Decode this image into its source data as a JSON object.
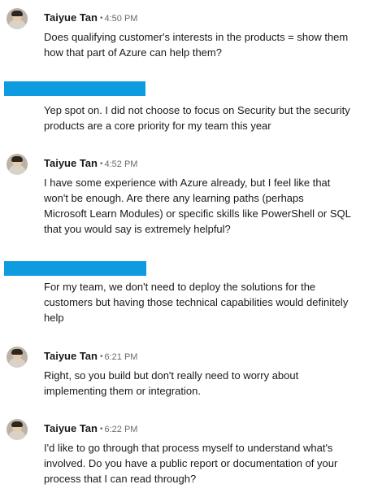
{
  "messages": [
    {
      "sender": "Taiyue Tan",
      "time": "4:50 PM",
      "lines": [
        "Does qualifying customer's interests in the products = show them",
        "how that part of Azure can help them?"
      ]
    },
    {
      "redacted": true,
      "lines": [
        "Yep spot on. I did not choose to focus on Security but the security",
        "products are a core priority for my team this year"
      ]
    },
    {
      "sender": "Taiyue Tan",
      "time": "4:52 PM",
      "lines": [
        "I have some experience with Azure already, but I feel like that",
        "won't be enough. Are there any learning paths (perhaps",
        "Microsoft Learn Modules) or specific skills like PowerShell or SQL",
        "that you would say is extremely helpful?"
      ]
    },
    {
      "redacted": true,
      "lines": [
        "For my team, we don't need to deploy the solutions for the",
        "customers but having those technical capabilities would definitely",
        "help"
      ]
    },
    {
      "sender": "Taiyue Tan",
      "time": "6:21 PM",
      "lines": [
        "Right, so you build but don't really need to worry about",
        "implementing them or integration."
      ]
    },
    {
      "sender": "Taiyue Tan",
      "time": "6:22 PM",
      "lines": [
        "I'd like to go through that process myself to understand what's",
        "involved. Do you have a public report or documentation of your",
        "process that I can read through?"
      ]
    }
  ],
  "separator": "•",
  "colors": {
    "redaction": "#0f9be0",
    "text": "#1f1f1f",
    "meta": "#666666"
  }
}
